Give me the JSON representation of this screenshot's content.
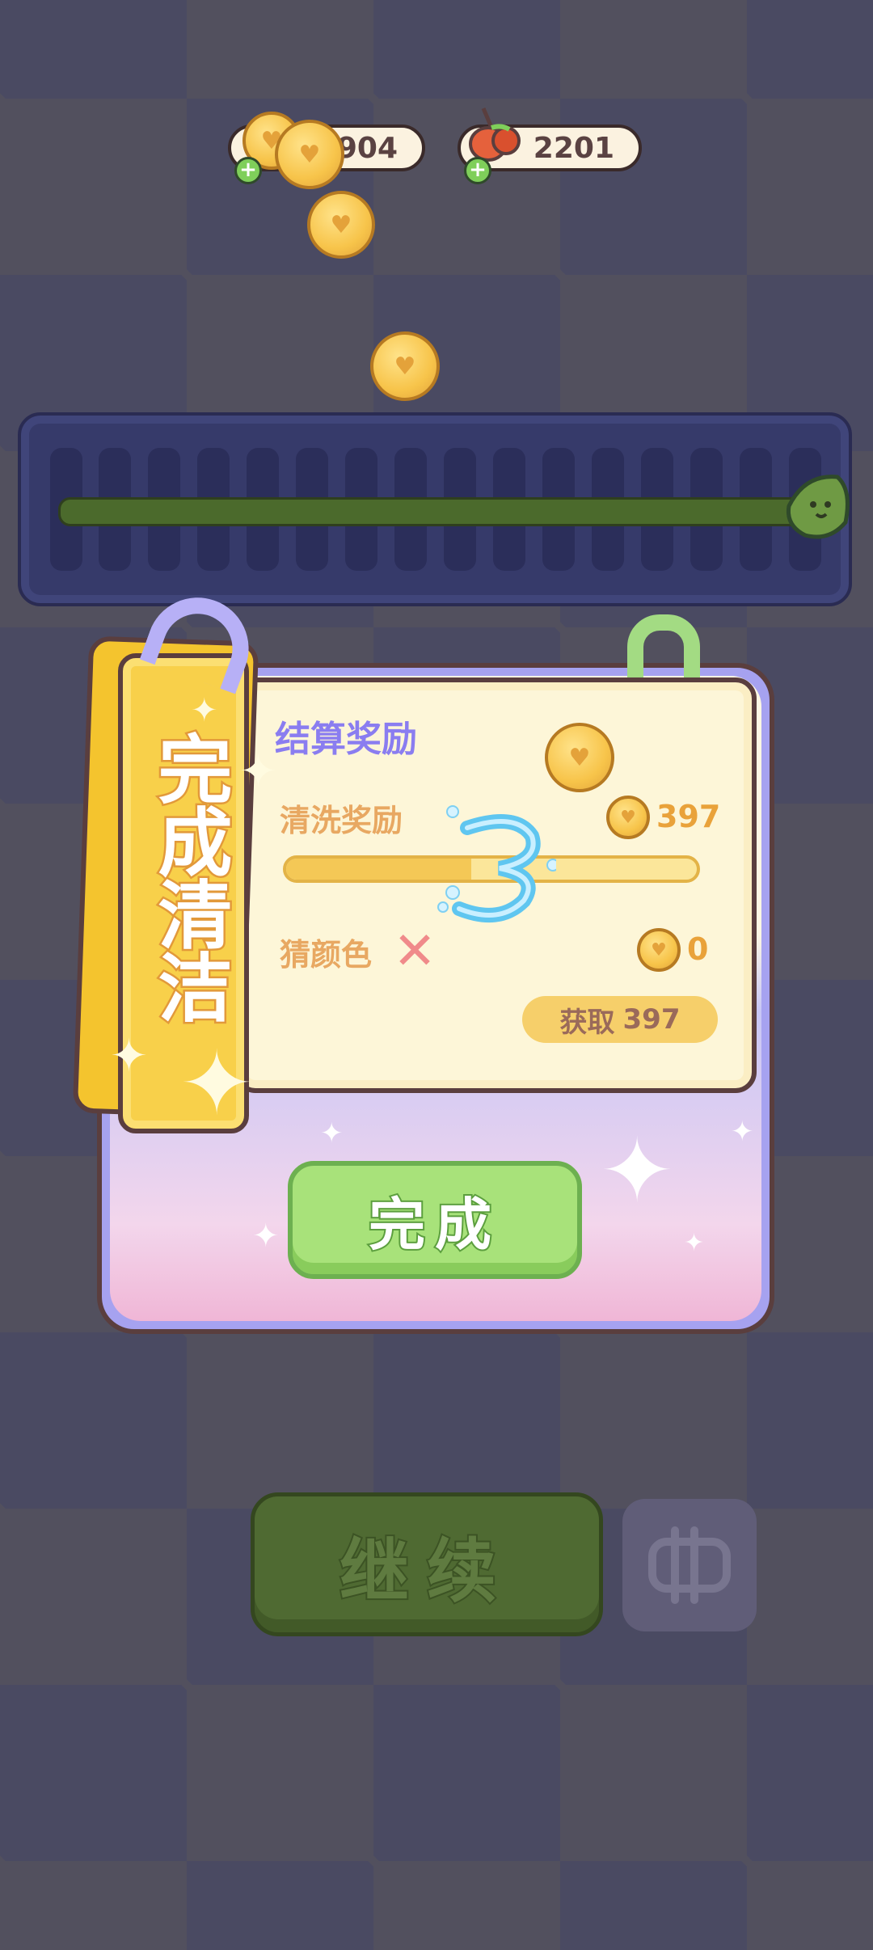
{
  "currency": {
    "coins": {
      "value": "904",
      "icon": "coin-icon"
    },
    "tomatoes": {
      "value": "2201",
      "icon": "tomato-icon"
    }
  },
  "dialog": {
    "tag_title": "完成清洁",
    "section_title": "结算奖励",
    "wash_reward_label": "清洗奖励",
    "wash_reward_value": "397",
    "wash_progress": 0.45,
    "guess_color_label": "猜颜色",
    "guess_color_value": "0",
    "claim_label": "获取",
    "claim_value": "397",
    "done_label": "完成"
  },
  "bottom": {
    "continue_label": "继续"
  },
  "colors": {
    "accent_green": "#a8e27a",
    "coin_gold": "#f7c44a",
    "label_orange": "#e8a862",
    "title_purple": "#8a7df0"
  }
}
